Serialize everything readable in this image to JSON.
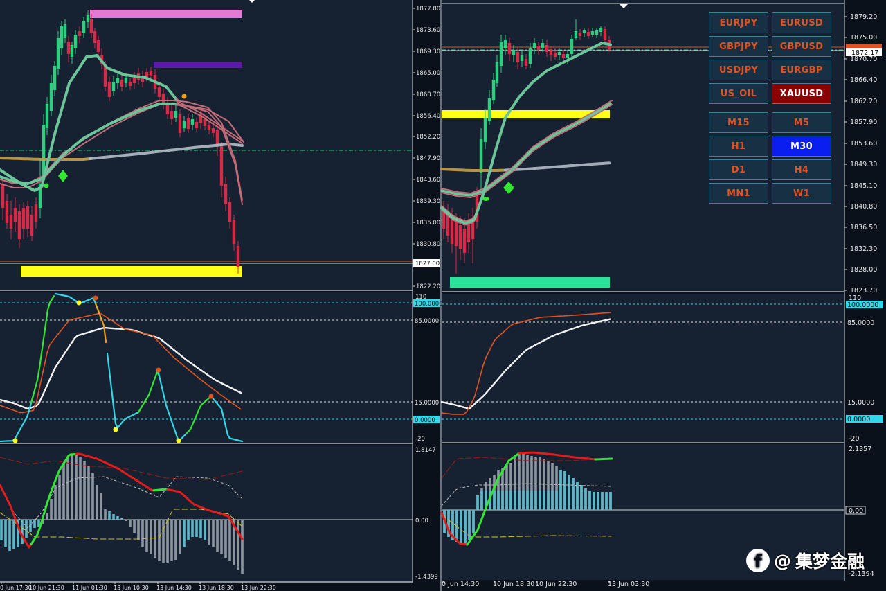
{
  "theme": {
    "bg": "#0b111b",
    "panel_bg": "#162231",
    "bull": "#2bd07e",
    "bear": "#d62a46",
    "fast_ma": "#6cc49a",
    "envelope": "#c46b78",
    "slow_ma": "#b3bcc8",
    "yellow_band": "#ffff1a",
    "osc_cyan": "#32d7ea",
    "osc_orange": "#e2521f",
    "osc_white": "#f2f2f2",
    "macd_green": "#32e632",
    "macd_red": "#e21b1b",
    "hist_grey": "#8c96a0",
    "hist_cyan": "#5cb6c8"
  },
  "left_chart": {
    "price_axis": [
      "1877.80",
      "1873.60",
      "1869.30",
      "1865.00",
      "1860.70",
      "1856.40",
      "1852.20",
      "1847.90",
      "1843.60",
      "1839.30",
      "1835.00",
      "1830.80",
      "1827.00",
      "1822.20"
    ],
    "current_price": "1827.00",
    "stoch_axis": {
      "top": "110",
      "level_100": "100.0000",
      "level_85": "85.0000",
      "level_15": "15.0000",
      "level_0": "0.0000",
      "bottom": "-20"
    },
    "macd_axis": {
      "top": "1.8147",
      "zero": "0.00",
      "bottom": "-1.4399"
    },
    "time_axis": [
      "0 Jun 17:30",
      "10 Jun 21:30",
      "11 Jun 01:30",
      "13 Jun 10:30",
      "13 Jun 14:30",
      "13 Jun 18:30",
      "13 Jun 22:30"
    ]
  },
  "right_chart": {
    "price_axis": [
      "1879.20",
      "1875.00",
      "1870.70",
      "1866.40",
      "1862.20",
      "1857.90",
      "1853.60",
      "1849.30",
      "1845.10",
      "1840.80",
      "1836.50",
      "1832.30",
      "1828.00",
      "1823.70"
    ],
    "current_price": "1872.17",
    "stoch_axis": {
      "top": "110",
      "level_100": "100.0000",
      "level_85": "85.0000",
      "level_15": "15.0000",
      "level_0": "0.0000",
      "bottom": "-20"
    },
    "macd_axis": {
      "top": "2.1357",
      "zero": "0.00",
      "bottom": "-2.1394"
    },
    "time_axis": [
      "0 Jun 14:30",
      "10 Jun 18:30",
      "10 Jun 22:30",
      "13 Jun 03:30"
    ]
  },
  "symbols": [
    {
      "label": "EURJPY",
      "selected": false
    },
    {
      "label": "EURUSD",
      "selected": false
    },
    {
      "label": "GBPJPY",
      "selected": false
    },
    {
      "label": "GBPUSD",
      "selected": false
    },
    {
      "label": "USDJPY",
      "selected": false
    },
    {
      "label": "EURGBP",
      "selected": false
    },
    {
      "label": "US_OIL",
      "selected": false
    },
    {
      "label": "XAUUSD",
      "selected": true
    }
  ],
  "timeframes": [
    {
      "label": "M15",
      "selected": false
    },
    {
      "label": "M5",
      "selected": false
    },
    {
      "label": "H1",
      "selected": false
    },
    {
      "label": "M30",
      "selected": true
    },
    {
      "label": "D1",
      "selected": false
    },
    {
      "label": "H4",
      "selected": false
    },
    {
      "label": "MN1",
      "selected": false
    },
    {
      "label": "W1",
      "selected": false
    }
  ],
  "watermark": {
    "at": "@",
    "text": "集梦金融",
    "icon": "facebook-icon"
  }
}
